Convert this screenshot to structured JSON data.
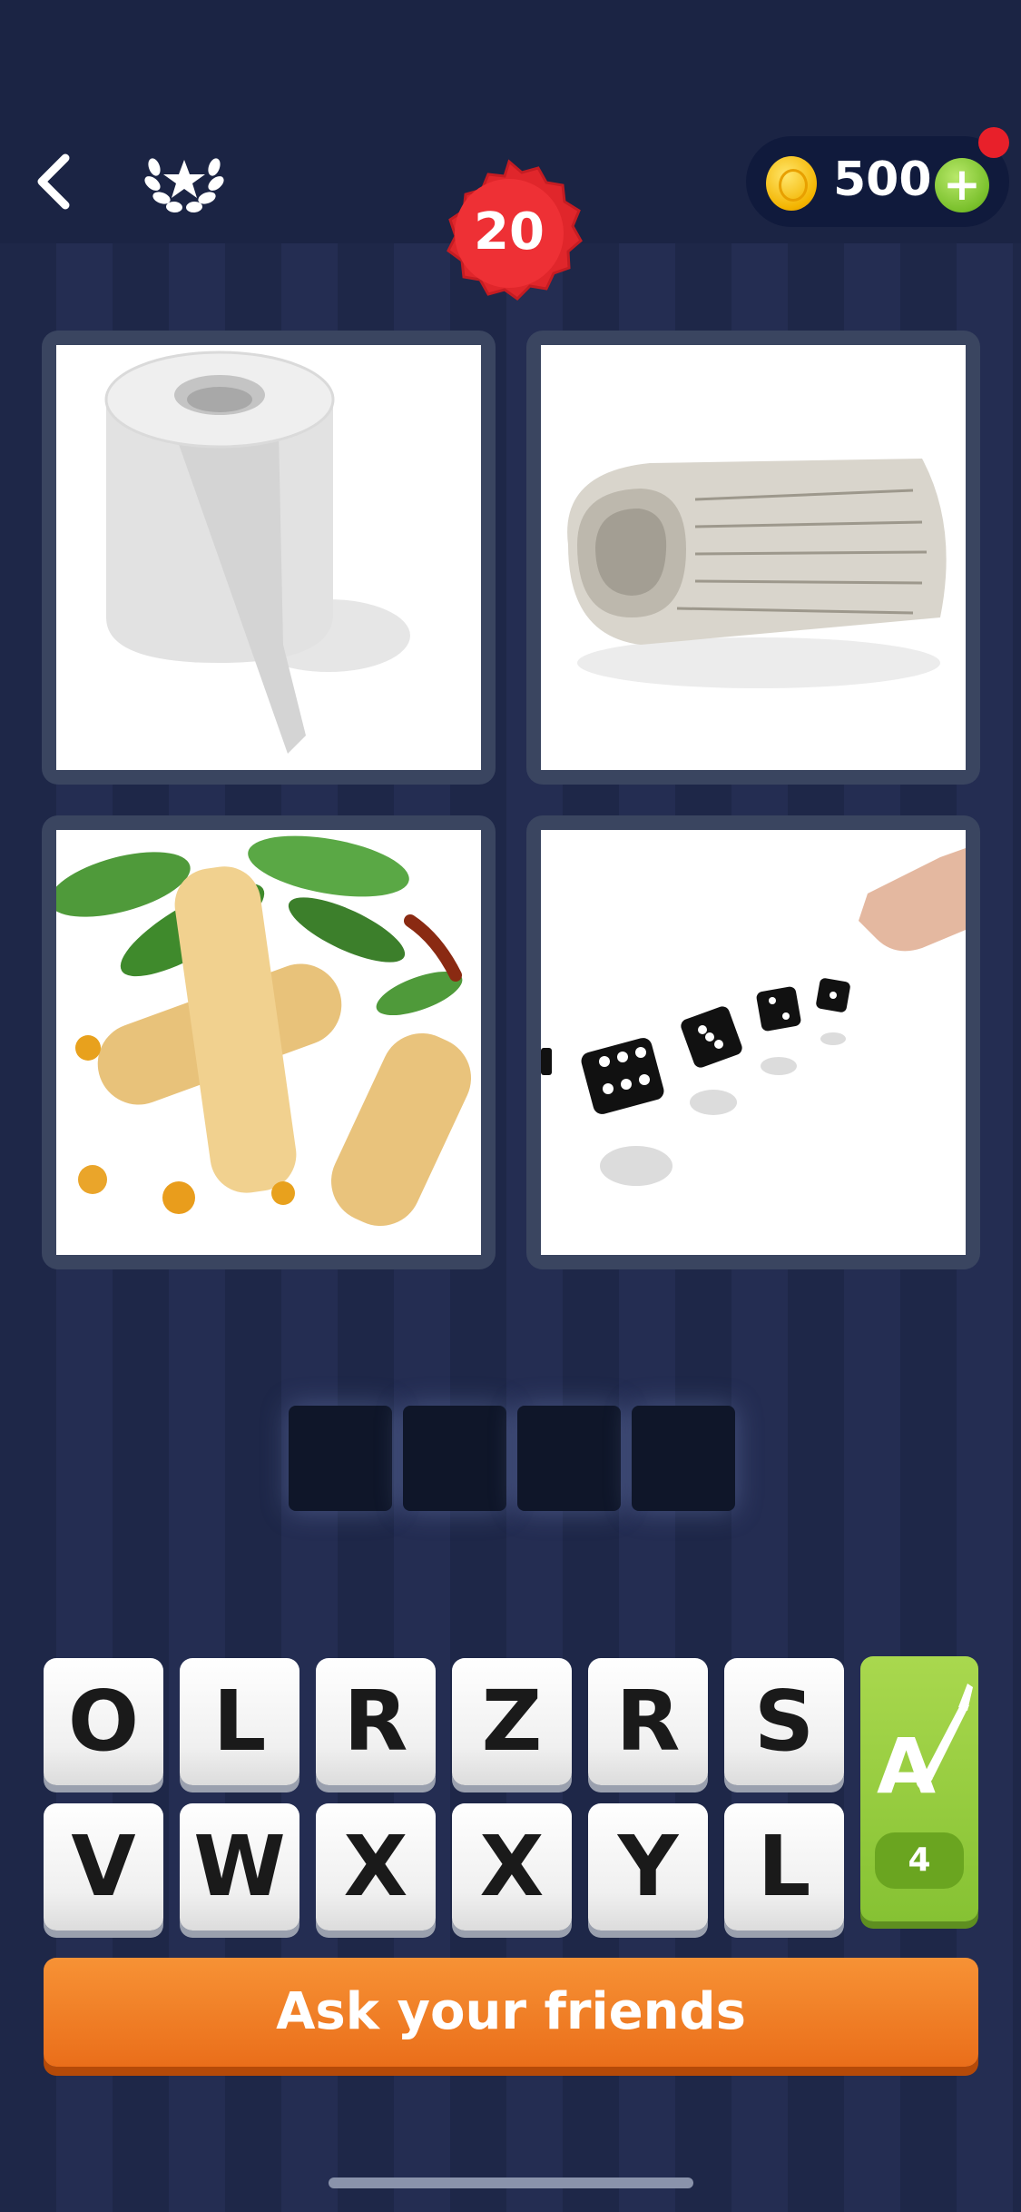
{
  "header": {
    "back_icon": "chevron-left-icon",
    "rank_icon": "laurel-star-icon",
    "coins": {
      "amount": "500",
      "coin_icon": "coin-icon",
      "add_icon": "plus-icon"
    },
    "level": "20"
  },
  "pictures": [
    {
      "subject": "toilet-paper-roll"
    },
    {
      "subject": "rolled-newspaper"
    },
    {
      "subject": "spring-rolls"
    },
    {
      "subject": "rolling-dice"
    }
  ],
  "answer_slots": 4,
  "letters": {
    "row1": [
      "O",
      "L",
      "R",
      "Z",
      "R",
      "S"
    ],
    "row2": [
      "V",
      "W",
      "X",
      "X",
      "Y",
      "L"
    ]
  },
  "hint": {
    "icon": "magic-brush-icon",
    "count": "4"
  },
  "ask_button": {
    "label": "Ask your friends"
  },
  "colors": {
    "background": "#1e2748",
    "accent_orange": "#f07c22",
    "hint_green": "#8cc63f",
    "badge_red": "#e0262b"
  }
}
